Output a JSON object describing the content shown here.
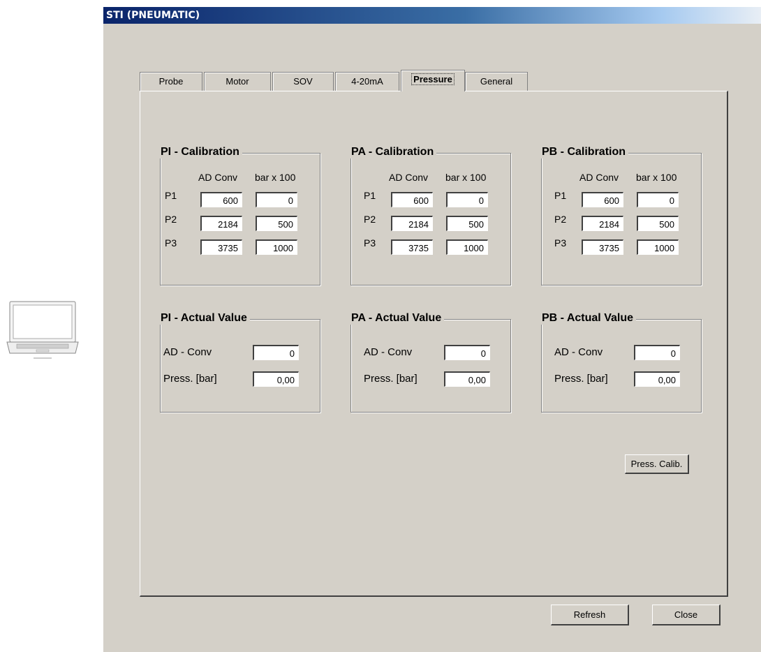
{
  "window": {
    "title": "STI (PNEUMATIC)"
  },
  "tabs": [
    {
      "label": "Probe",
      "active": false
    },
    {
      "label": "Motor",
      "active": false
    },
    {
      "label": "SOV",
      "active": false
    },
    {
      "label": "4-20mA",
      "active": false
    },
    {
      "label": "Pressure",
      "active": true
    },
    {
      "label": "General",
      "active": false
    }
  ],
  "calibration": {
    "col_ad": "AD Conv",
    "col_bar": "bar x 100",
    "groups": [
      {
        "title": "PI - Calibration",
        "rows": [
          {
            "label": "P1",
            "ad": "600",
            "bar": "0"
          },
          {
            "label": "P2",
            "ad": "2184",
            "bar": "500"
          },
          {
            "label": "P3",
            "ad": "3735",
            "bar": "1000"
          }
        ]
      },
      {
        "title": "PA - Calibration",
        "rows": [
          {
            "label": "P1",
            "ad": "600",
            "bar": "0"
          },
          {
            "label": "P2",
            "ad": "2184",
            "bar": "500"
          },
          {
            "label": "P3",
            "ad": "3735",
            "bar": "1000"
          }
        ]
      },
      {
        "title": "PB - Calibration",
        "rows": [
          {
            "label": "P1",
            "ad": "600",
            "bar": "0"
          },
          {
            "label": "P2",
            "ad": "2184",
            "bar": "500"
          },
          {
            "label": "P3",
            "ad": "3735",
            "bar": "1000"
          }
        ]
      }
    ]
  },
  "actual": {
    "ad_label": "AD - Conv",
    "press_label": "Press. [bar]",
    "groups": [
      {
        "title": "PI - Actual Value",
        "ad": "0",
        "press": "0,00"
      },
      {
        "title": "PA - Actual Value",
        "ad": "0",
        "press": "0,00"
      },
      {
        "title": "PB - Actual Value",
        "ad": "0",
        "press": "0,00"
      }
    ]
  },
  "buttons": {
    "press_calib": "Press. Calib.",
    "refresh": "Refresh",
    "close": "Close"
  },
  "colors": {
    "dialog_bg": "#d4d0c8",
    "title_bar": "#0a246a"
  },
  "icons": {
    "left_device": "laptop-icon"
  }
}
